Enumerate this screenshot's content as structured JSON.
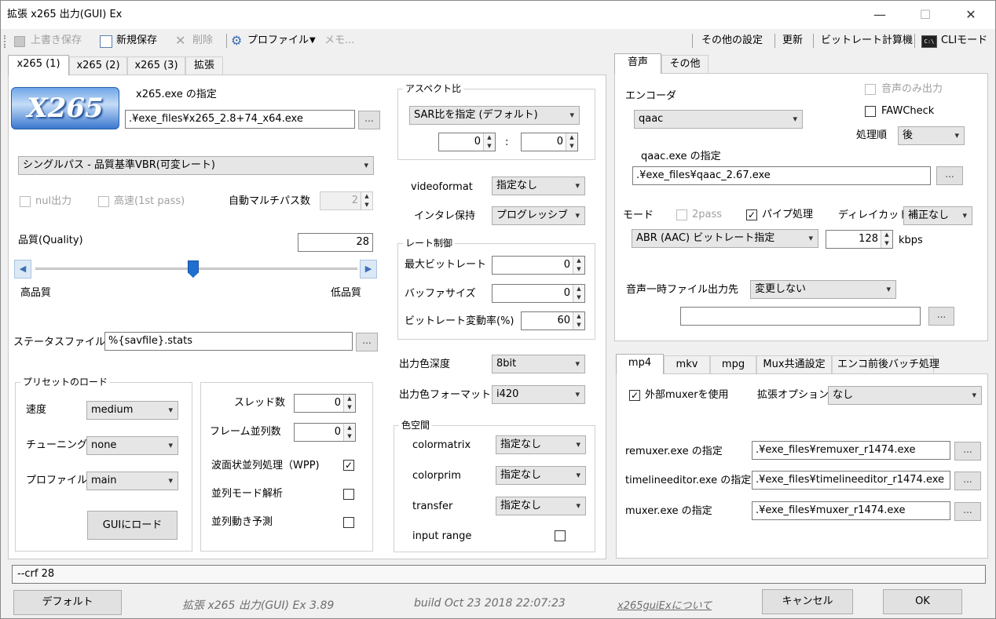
{
  "window": {
    "title": "拡張 x265 出力(GUI) Ex",
    "minimize": "—",
    "maximize": "☐",
    "close": "✕"
  },
  "toolbar": {
    "overwrite_save": "上書き保存",
    "new_save": "新規保存",
    "delete": "削除",
    "profile": "プロファイル",
    "memo": "メモ...",
    "other_settings": "その他の設定",
    "update": "更新",
    "bitrate_calc": "ビットレート計算機",
    "cli_mode": "CLIモード"
  },
  "video_tabs": [
    "x265 (1)",
    "x265 (2)",
    "x265 (3)",
    "拡張"
  ],
  "video": {
    "logo_text": "X265",
    "exe_label": "x265.exe の指定",
    "exe_path": ".¥exe_files¥x265_2.8+74_x64.exe",
    "mode": "シングルパス - 品質基準VBR(可変レート)",
    "nul_output": "nul出力",
    "fast_first_pass": "高速(1st pass)",
    "auto_multipass_label": "自動マルチパス数",
    "auto_multipass_value": "2",
    "quality_label": "品質(Quality)",
    "quality_value": "28",
    "quality_level": 0.49,
    "high_quality": "高品質",
    "low_quality": "低品質",
    "stats_label": "ステータスファイル",
    "stats_value": "%{savfile}.stats",
    "preset_group": "プリセットのロード",
    "speed_label": "速度",
    "speed_value": "medium",
    "tuning_label": "チューニング",
    "tuning_value": "none",
    "profile_label": "プロファイル",
    "profile_value": "main",
    "load_gui": "GUIにロード",
    "threads_label": "スレッド数",
    "threads_value": "0",
    "frame_threads_label": "フレーム並列数",
    "frame_threads_value": "0",
    "wpp_label": "波面状並列処理（WPP)",
    "pmode_label": "並列モード解析",
    "pme_label": "並列動き予測",
    "aspect_group": "アスペクト比",
    "aspect_mode": "SAR比を指定 (デフォルト)",
    "sar_x": "0",
    "sar_sep": ":",
    "sar_y": "0",
    "videoformat_label": "videoformat",
    "videoformat_value": "指定なし",
    "interlace_label": "インタレ保持",
    "interlace_value": "プログレッシブ",
    "rate_group": "レート制御",
    "max_bitrate_label": "最大ビットレート",
    "max_bitrate_value": "0",
    "buffer_label": "バッファサイズ",
    "buffer_value": "0",
    "bitrate_var_label": "ビットレート変動率(%)",
    "bitrate_var_value": "60",
    "depth_label": "出力色深度",
    "depth_value": "8bit",
    "color_format_label": "出力色フォーマット",
    "color_format_value": "i420",
    "colorspace_group": "色空間",
    "colormatrix_label": "colormatrix",
    "colormatrix_value": "指定なし",
    "colorprim_label": "colorprim",
    "colorprim_value": "指定なし",
    "transfer_label": "transfer",
    "transfer_value": "指定なし",
    "input_range_label": "input range"
  },
  "audio_tabs": [
    "音声",
    "その他"
  ],
  "audio": {
    "encoder_label": "エンコーダ",
    "encoder_value": "qaac",
    "audio_only": "音声のみ出力",
    "faw_check": "FAWCheck",
    "order_label": "処理順",
    "order_value": "後",
    "exe_label": "qaac.exe の指定",
    "exe_path": ".¥exe_files¥qaac_2.67.exe",
    "mode_label": "モード",
    "twopass": "2pass",
    "pipe": "パイプ処理",
    "delay_cut_label": "ディレイカット",
    "delay_cut_value": "補正なし",
    "mode_value": "ABR (AAC) ビットレート指定",
    "bitrate_value": "128",
    "kbps": "kbps",
    "temp_label": "音声一時ファイル出力先",
    "temp_value": "変更しない"
  },
  "mux_tabs": [
    "mp4",
    "mkv",
    "mpg",
    "Mux共通設定",
    "エンコ前後バッチ処理"
  ],
  "mux": {
    "external_muxer": "外部muxerを使用",
    "ext_option_label": "拡張オプション",
    "ext_option_value": "なし",
    "remuxer_label": "remuxer.exe の指定",
    "remuxer_path": ".¥exe_files¥remuxer_r1474.exe",
    "timeline_label": "timelineeditor.exe の指定",
    "timeline_path": ".¥exe_files¥timelineeditor_r1474.exe",
    "muxer_label": "muxer.exe の指定",
    "muxer_path": ".¥exe_files¥muxer_r1474.exe"
  },
  "status": {
    "cmdline": "--crf 28"
  },
  "footer": {
    "default_btn": "デフォルト",
    "version": "拡張 x265 出力(GUI) Ex 3.89",
    "build": "build Oct 23 2018 22:07:23",
    "about": "x265guiExについて",
    "cancel": "キャンセル",
    "ok": "OK"
  },
  "common": {
    "browse": "...",
    "dropdown": "▾",
    "check": "✓",
    "spin_up": "▲",
    "spin_down": "▼",
    "arrow_left": "◀",
    "arrow_right": "▶"
  }
}
